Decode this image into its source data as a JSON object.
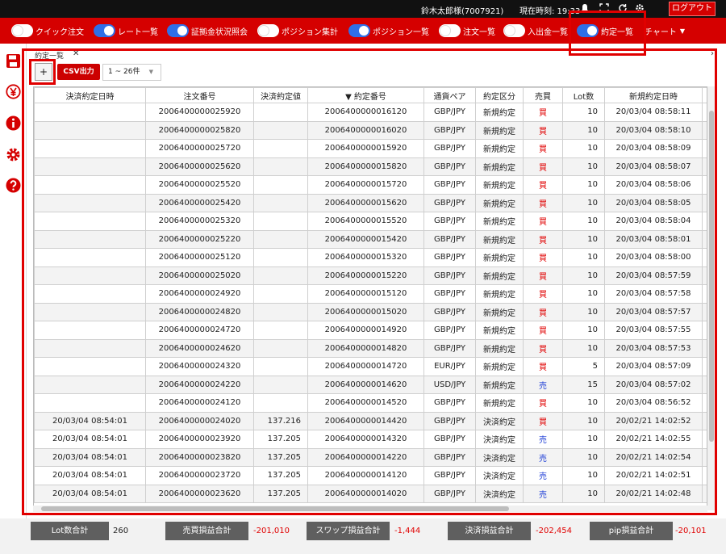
{
  "header": {
    "user": "鈴木太郎様(7007921)",
    "clock": "現在時刻: 19:33",
    "logout_label": "ログアウト"
  },
  "menu": {
    "items": [
      {
        "label": "クイック注文",
        "on": false
      },
      {
        "label": "レート一覧",
        "on": true
      },
      {
        "label": "証拠金状況照会",
        "on": true
      },
      {
        "label": "ポジション集計",
        "on": false
      },
      {
        "label": "ポジション一覧",
        "on": true
      },
      {
        "label": "注文一覧",
        "on": false
      },
      {
        "label": "入出金一覧",
        "on": false
      },
      {
        "label": "約定一覧",
        "on": true
      }
    ],
    "chart_label": "チャート"
  },
  "panel": {
    "tab_title": "約定一覧",
    "close_glyph": "✕",
    "add_label": "+",
    "csv_label": "CSV出力",
    "page_range": "1 ~ 26件"
  },
  "table": {
    "columns": [
      "決済約定日時",
      "注文番号",
      "決済約定値",
      "▼ 約定番号",
      "通貨ペア",
      "約定区分",
      "売買",
      "Lot数",
      "新規約定日時",
      "新"
    ],
    "rows": [
      [
        "",
        "2006400000025920",
        "",
        "2006400000016120",
        "GBP/JPY",
        "新規約定",
        "買",
        "10",
        "20/03/04 08:58:11"
      ],
      [
        "",
        "2006400000025820",
        "",
        "2006400000016020",
        "GBP/JPY",
        "新規約定",
        "買",
        "10",
        "20/03/04 08:58:10"
      ],
      [
        "",
        "2006400000025720",
        "",
        "2006400000015920",
        "GBP/JPY",
        "新規約定",
        "買",
        "10",
        "20/03/04 08:58:09"
      ],
      [
        "",
        "2006400000025620",
        "",
        "2006400000015820",
        "GBP/JPY",
        "新規約定",
        "買",
        "10",
        "20/03/04 08:58:07"
      ],
      [
        "",
        "2006400000025520",
        "",
        "2006400000015720",
        "GBP/JPY",
        "新規約定",
        "買",
        "10",
        "20/03/04 08:58:06"
      ],
      [
        "",
        "2006400000025420",
        "",
        "2006400000015620",
        "GBP/JPY",
        "新規約定",
        "買",
        "10",
        "20/03/04 08:58:05"
      ],
      [
        "",
        "2006400000025320",
        "",
        "2006400000015520",
        "GBP/JPY",
        "新規約定",
        "買",
        "10",
        "20/03/04 08:58:04"
      ],
      [
        "",
        "2006400000025220",
        "",
        "2006400000015420",
        "GBP/JPY",
        "新規約定",
        "買",
        "10",
        "20/03/04 08:58:01"
      ],
      [
        "",
        "2006400000025120",
        "",
        "2006400000015320",
        "GBP/JPY",
        "新規約定",
        "買",
        "10",
        "20/03/04 08:58:00"
      ],
      [
        "",
        "2006400000025020",
        "",
        "2006400000015220",
        "GBP/JPY",
        "新規約定",
        "買",
        "10",
        "20/03/04 08:57:59"
      ],
      [
        "",
        "2006400000024920",
        "",
        "2006400000015120",
        "GBP/JPY",
        "新規約定",
        "買",
        "10",
        "20/03/04 08:57:58"
      ],
      [
        "",
        "2006400000024820",
        "",
        "2006400000015020",
        "GBP/JPY",
        "新規約定",
        "買",
        "10",
        "20/03/04 08:57:57"
      ],
      [
        "",
        "2006400000024720",
        "",
        "2006400000014920",
        "GBP/JPY",
        "新規約定",
        "買",
        "10",
        "20/03/04 08:57:55"
      ],
      [
        "",
        "2006400000024620",
        "",
        "2006400000014820",
        "GBP/JPY",
        "新規約定",
        "買",
        "10",
        "20/03/04 08:57:53"
      ],
      [
        "",
        "2006400000024320",
        "",
        "2006400000014720",
        "EUR/JPY",
        "新規約定",
        "買",
        "5",
        "20/03/04 08:57:09"
      ],
      [
        "",
        "2006400000024220",
        "",
        "2006400000014620",
        "USD/JPY",
        "新規約定",
        "売",
        "15",
        "20/03/04 08:57:02"
      ],
      [
        "",
        "2006400000024120",
        "",
        "2006400000014520",
        "GBP/JPY",
        "新規約定",
        "買",
        "10",
        "20/03/04 08:56:52"
      ],
      [
        "20/03/04 08:54:01",
        "2006400000024020",
        "137.216",
        "2006400000014420",
        "GBP/JPY",
        "決済約定",
        "買",
        "10",
        "20/02/21 14:02:52"
      ],
      [
        "20/03/04 08:54:01",
        "2006400000023920",
        "137.205",
        "2006400000014320",
        "GBP/JPY",
        "決済約定",
        "売",
        "10",
        "20/02/21 14:02:55"
      ],
      [
        "20/03/04 08:54:01",
        "2006400000023820",
        "137.205",
        "2006400000014220",
        "GBP/JPY",
        "決済約定",
        "売",
        "10",
        "20/02/21 14:02:54"
      ],
      [
        "20/03/04 08:54:01",
        "2006400000023720",
        "137.205",
        "2006400000014120",
        "GBP/JPY",
        "決済約定",
        "売",
        "10",
        "20/02/21 14:02:51"
      ],
      [
        "20/03/04 08:54:01",
        "2006400000023620",
        "137.205",
        "2006400000014020",
        "GBP/JPY",
        "決済約定",
        "売",
        "10",
        "20/02/21 14:02:48"
      ]
    ]
  },
  "totals": {
    "lot_label": "Lot数合計",
    "lot_value": "260",
    "trade_label": "売買損益合計",
    "trade_value": "-201,010",
    "swap_label": "スワップ損益合計",
    "swap_value": "-1,444",
    "settle_label": "決済損益合計",
    "settle_value": "-202,454",
    "pip_label": "pip損益合計",
    "pip_value": "-20,101"
  },
  "colors": {
    "brand_red": "#d50000",
    "toggle_on": "#2f6fe8",
    "buy": "#e00000",
    "sell": "#1f3fd6"
  }
}
